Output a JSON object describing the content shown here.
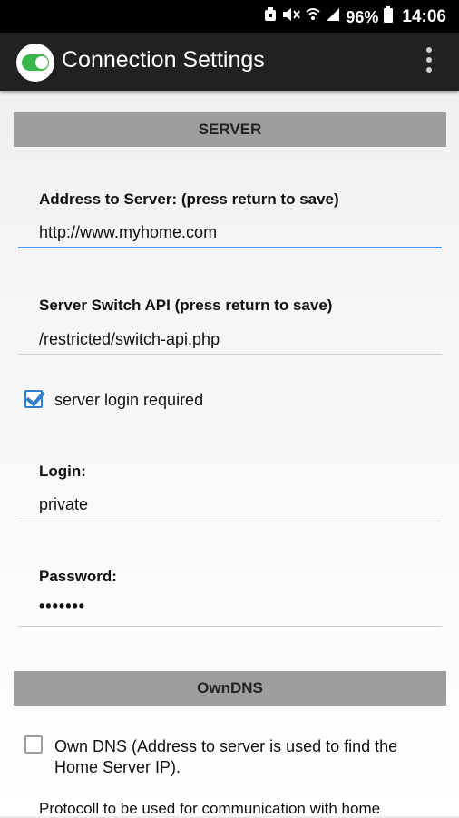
{
  "status_bar": {
    "battery_percent": "96%",
    "time": "14:06",
    "icons": [
      "alarm-icon",
      "mute-icon",
      "wifi-icon",
      "signal-icon",
      "battery-icon"
    ]
  },
  "app_bar": {
    "title": "Connection Settings",
    "logo_icon": "toggle-switch-icon",
    "menu_icon": "overflow-menu-icon"
  },
  "server_section": {
    "header": "SERVER",
    "address": {
      "label": "Address to Server: (press return to save)",
      "value": "http://www.myhome.com"
    },
    "switch_api": {
      "label": "Server Switch API (press return to save)",
      "value": "/restricted/switch-api.php"
    },
    "login_required": {
      "label": "server login required",
      "checked": true
    },
    "login": {
      "label": "Login:",
      "value": "private"
    },
    "password": {
      "label": "Password:",
      "value": "•••••••"
    }
  },
  "owndns_section": {
    "header": "OwnDNS",
    "own_dns": {
      "label_line1": "Own DNS (Address to server is used to find the",
      "label_line2": "Home Server IP).",
      "checked": false
    },
    "protocol_text": "Protocoll to be used for communication with home"
  },
  "colors": {
    "accent": "#2f7fd1",
    "toggle_green": "#39b54a",
    "app_bar": "#212121",
    "section_header": "#9e9e9e"
  }
}
